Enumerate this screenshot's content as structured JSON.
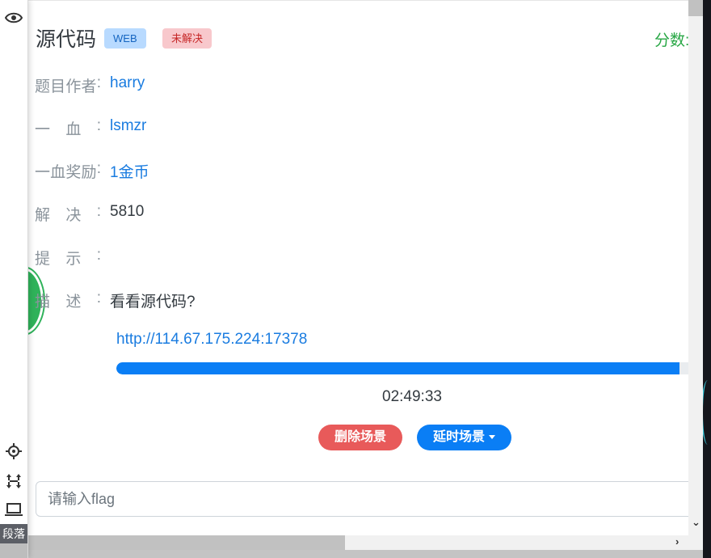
{
  "challenge": {
    "title": "源代码",
    "category_badge": "WEB",
    "status_badge": "未解决",
    "score_label": "分数:"
  },
  "details": {
    "author": {
      "label": [
        "题",
        "目",
        "作",
        "者",
        ":"
      ],
      "value": "harry"
    },
    "first_blood": {
      "label": [
        "一",
        "血",
        ":"
      ],
      "value": "lsmzr"
    },
    "first_blood_reward": {
      "label": [
        "一",
        "血",
        "奖",
        "励",
        ":"
      ],
      "value": "1金币"
    },
    "solves": {
      "label": [
        "解",
        "决",
        ":"
      ],
      "value": "5810"
    },
    "hint": {
      "label": [
        "提",
        "示",
        ":"
      ],
      "value": ""
    },
    "description": {
      "label": [
        "描",
        "述",
        ":"
      ],
      "value": "看看源代码?"
    }
  },
  "environment": {
    "url": "http://114.67.175.224:17378",
    "progress": 0.985,
    "countdown": "02:49:33",
    "delete_button": "删除场景",
    "extend_button": "延时场景"
  },
  "flag_input": {
    "placeholder": "请输入flag",
    "value": ""
  },
  "toolbar": {
    "label": "段落",
    "icons": [
      "eye-icon",
      "crosshair-icon",
      "move-arrows-icon",
      "laptop-icon"
    ]
  },
  "colors": {
    "link_blue": "#1a7ce0",
    "score_green": "#28a745",
    "delete_red": "#e85a5a",
    "primary_blue": "#0a7ef5"
  }
}
